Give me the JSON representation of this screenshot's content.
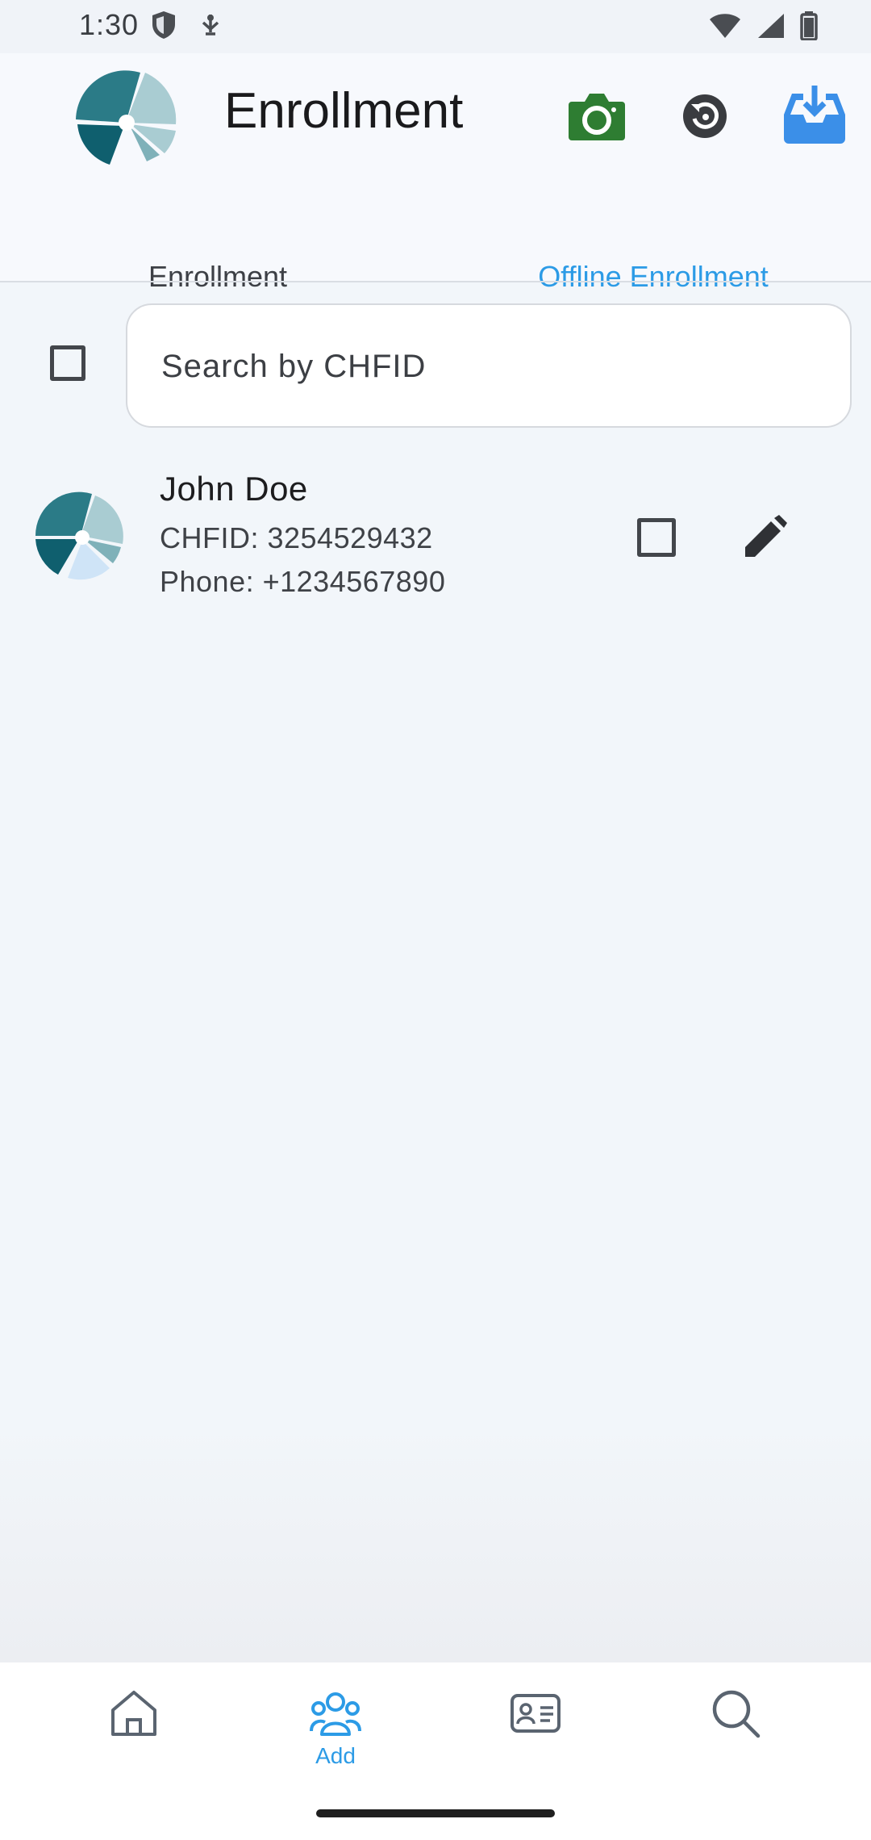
{
  "status_bar": {
    "time": "1:30",
    "icons_left": [
      "shield-icon",
      "usb-debug-icon"
    ],
    "icons_right": [
      "wifi-icon",
      "signal-icon",
      "battery-icon"
    ]
  },
  "header": {
    "title": "Enrollment",
    "logo": "openimis-logo",
    "actions": [
      {
        "name": "camera-icon",
        "color": "#2e7d32"
      },
      {
        "name": "history-icon",
        "color": "#3a3c40"
      },
      {
        "name": "download-tray-icon",
        "color": "#3b8fe8"
      }
    ]
  },
  "tabs": [
    {
      "label": "Enrollment",
      "active": false
    },
    {
      "label": "Offline Enrollment",
      "active": true
    }
  ],
  "search": {
    "placeholder": "Search by CHFID",
    "value": ""
  },
  "items": [
    {
      "name": "John Doe",
      "chfid_line": "CHFID: 3254529432",
      "phone_line": "Phone: +1234567890",
      "checked": false
    }
  ],
  "bottom_nav": [
    {
      "icon": "home-icon",
      "label": "",
      "active": false
    },
    {
      "icon": "users-add-icon",
      "label": "Add",
      "active": true
    },
    {
      "icon": "id-card-icon",
      "label": "",
      "active": false
    },
    {
      "icon": "search-icon",
      "label": "",
      "active": false
    }
  ],
  "colors": {
    "accent": "#2c9be6",
    "background": "#f2f6fa",
    "camera": "#2e7d32"
  }
}
